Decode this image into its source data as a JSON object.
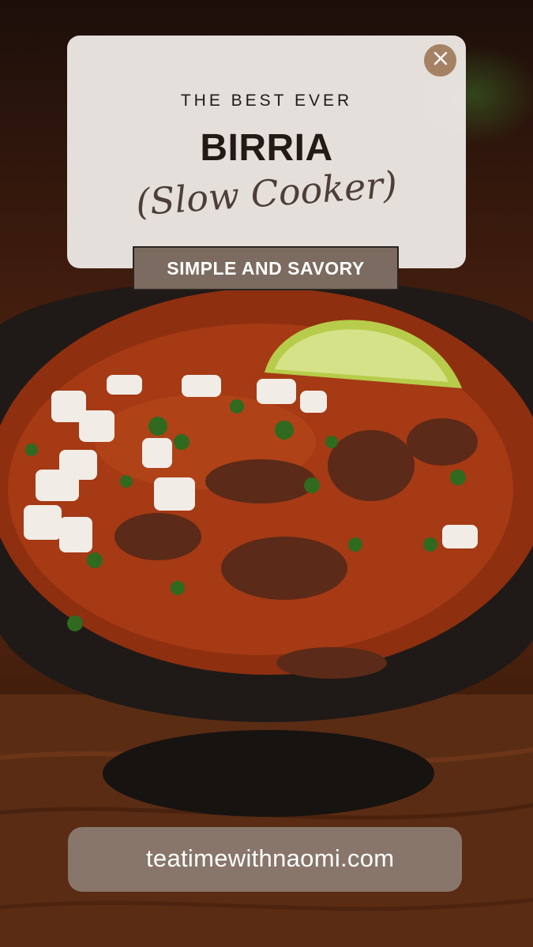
{
  "header": {
    "kicker": "THE BEST EVER",
    "title": "BIRRIA",
    "subtitle": "(Slow Cooker)",
    "tagline": "SIMPLE AND SAVORY"
  },
  "close_icon": "close-icon",
  "footer": {
    "icon": "globe-icon",
    "website": "teatimewithnaomi.com"
  },
  "colors": {
    "card_bg": "#F0ECE9",
    "close_button": "#A68265",
    "tagline_bg": "#7C6B60",
    "pill_bg": "#8B7A70",
    "text_dark": "#231A16"
  }
}
